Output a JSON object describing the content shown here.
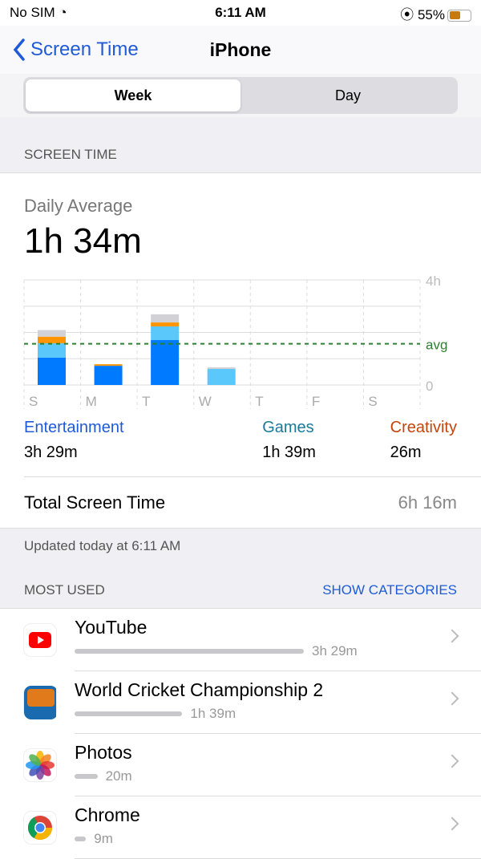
{
  "status": {
    "carrier": "No SIM",
    "time": "6:11 AM",
    "battery": "55%",
    "battery_level": 0.55
  },
  "nav": {
    "back": "Screen Time",
    "title": "iPhone"
  },
  "segment": {
    "options": [
      "Week",
      "Day"
    ],
    "selected": "Week"
  },
  "section_screen_time": "SCREEN TIME",
  "summary": {
    "label": "Daily Average",
    "value": "1h 34m"
  },
  "chart_data": {
    "type": "bar",
    "stacked": true,
    "categories": [
      "S",
      "M",
      "T",
      "W",
      "T",
      "F",
      "S"
    ],
    "y_ticks": [
      "4h",
      "avg",
      "0"
    ],
    "ylim": [
      0,
      4
    ],
    "unit": "hours",
    "avg": 1.57,
    "series": [
      {
        "name": "Entertainment",
        "color": "#007aff",
        "values": [
          1.04,
          0.73,
          1.71,
          0,
          0,
          0,
          0
        ]
      },
      {
        "name": "Games",
        "color": "#5ac8fa",
        "values": [
          0.55,
          0,
          0.52,
          0.61,
          0,
          0,
          0
        ]
      },
      {
        "name": "Creativity",
        "color": "#ff9500",
        "values": [
          0.25,
          0.06,
          0.15,
          0,
          0,
          0,
          0
        ]
      },
      {
        "color": "#d1d1d6",
        "values": [
          0.25,
          0,
          0.31,
          0.06,
          0,
          0,
          0
        ]
      }
    ],
    "avg_color": "#2e7d32"
  },
  "categories": [
    {
      "name": "Entertainment",
      "time": "3h 29m",
      "color": "#1f5bd6"
    },
    {
      "name": "Games",
      "time": "1h 39m",
      "color": "#1a7a9a"
    },
    {
      "name": "Creativity",
      "time": "26m",
      "color": "#c4450c"
    }
  ],
  "total": {
    "label": "Total Screen Time",
    "value": "6h 16m"
  },
  "updated": "Updated today at 6:11 AM",
  "most_used": {
    "label": "MOST USED",
    "action": "SHOW CATEGORIES"
  },
  "apps": [
    {
      "name": "YouTube",
      "time": "3h 29m",
      "fraction": 1.0,
      "icon": "youtube-icon"
    },
    {
      "name": "World Cricket Championship 2",
      "time": "1h 39m",
      "fraction": 0.47,
      "icon": "wcc2-icon"
    },
    {
      "name": "Photos",
      "time": "20m",
      "fraction": 0.1,
      "icon": "photos-icon"
    },
    {
      "name": "Chrome",
      "time": "9m",
      "fraction": 0.05,
      "icon": "chrome-icon"
    }
  ]
}
